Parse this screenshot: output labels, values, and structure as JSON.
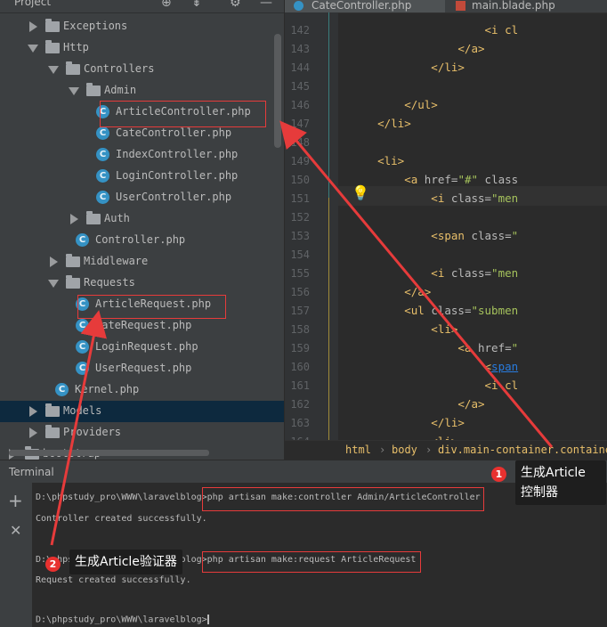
{
  "project": {
    "title": "Project",
    "tree": [
      {
        "label": "Exceptions",
        "type": "folder",
        "state": "closed"
      },
      {
        "label": "Http",
        "type": "folder",
        "state": "open"
      },
      {
        "label": "Controllers",
        "type": "folder",
        "state": "open"
      },
      {
        "label": "Admin",
        "type": "folder",
        "state": "open"
      },
      {
        "label": "ArticleController.php",
        "type": "class"
      },
      {
        "label": "CateController.php",
        "type": "class"
      },
      {
        "label": "IndexController.php",
        "type": "class"
      },
      {
        "label": "LoginController.php",
        "type": "class"
      },
      {
        "label": "UserController.php",
        "type": "class"
      },
      {
        "label": "Auth",
        "type": "folder",
        "state": "closed"
      },
      {
        "label": "Controller.php",
        "type": "class"
      },
      {
        "label": "Middleware",
        "type": "folder",
        "state": "closed"
      },
      {
        "label": "Requests",
        "type": "folder",
        "state": "open"
      },
      {
        "label": "ArticleRequest.php",
        "type": "class"
      },
      {
        "label": "CateRequest.php",
        "type": "class"
      },
      {
        "label": "LoginRequest.php",
        "type": "class"
      },
      {
        "label": "UserRequest.php",
        "type": "class"
      },
      {
        "label": "Kernel.php",
        "type": "class"
      },
      {
        "label": "Models",
        "type": "folder",
        "state": "closed"
      },
      {
        "label": "Providers",
        "type": "folder",
        "state": "closed"
      },
      {
        "label": "bootstrap",
        "type": "folder",
        "state": "closed"
      }
    ],
    "class_icon_letter": "C"
  },
  "editor": {
    "tabs": [
      {
        "label": "CateController.php"
      },
      {
        "label": "main.blade.php"
      }
    ],
    "lines": [
      {
        "n": "142",
        "segs": [
          {
            "c": "t",
            "v": "                    <i cl"
          }
        ]
      },
      {
        "n": "143",
        "segs": [
          {
            "c": "t",
            "v": "                </a>"
          }
        ]
      },
      {
        "n": "144",
        "segs": [
          {
            "c": "t",
            "v": "            </li>"
          }
        ]
      },
      {
        "n": "145",
        "segs": []
      },
      {
        "n": "146",
        "segs": [
          {
            "c": "t",
            "v": "        </ul>"
          }
        ]
      },
      {
        "n": "147",
        "segs": [
          {
            "c": "t",
            "v": "    </li>"
          }
        ]
      },
      {
        "n": "148",
        "segs": []
      },
      {
        "n": "149",
        "segs": [
          {
            "c": "t",
            "v": "    <li>"
          }
        ]
      },
      {
        "n": "150",
        "segs": [
          {
            "c": "t",
            "v": "        <a "
          },
          {
            "c": "a",
            "v": "href="
          },
          {
            "c": "s",
            "v": "\"#\""
          },
          {
            "c": "a",
            "v": " class"
          }
        ]
      },
      {
        "n": "151",
        "segs": [
          {
            "c": "t",
            "v": "            <i "
          },
          {
            "c": "a",
            "v": "class="
          },
          {
            "c": "s",
            "v": "\"men"
          }
        ]
      },
      {
        "n": "152",
        "segs": []
      },
      {
        "n": "153",
        "segs": [
          {
            "c": "t",
            "v": "            <span "
          },
          {
            "c": "a",
            "v": "class="
          },
          {
            "c": "s",
            "v": "\""
          }
        ]
      },
      {
        "n": "154",
        "segs": []
      },
      {
        "n": "155",
        "segs": [
          {
            "c": "t",
            "v": "            <i "
          },
          {
            "c": "a",
            "v": "class="
          },
          {
            "c": "s",
            "v": "\"men"
          }
        ]
      },
      {
        "n": "156",
        "segs": [
          {
            "c": "t",
            "v": "        </a>"
          }
        ]
      },
      {
        "n": "157",
        "segs": [
          {
            "c": "t",
            "v": "        <ul "
          },
          {
            "c": "a",
            "v": "class="
          },
          {
            "c": "s",
            "v": "\"submen"
          }
        ]
      },
      {
        "n": "158",
        "segs": [
          {
            "c": "t",
            "v": "            <li>"
          }
        ]
      },
      {
        "n": "159",
        "segs": [
          {
            "c": "t",
            "v": "                <a "
          },
          {
            "c": "a",
            "v": "href="
          },
          {
            "c": "s",
            "v": "\""
          }
        ]
      },
      {
        "n": "160",
        "segs": [
          {
            "c": "t",
            "v": "                    <"
          },
          {
            "c": "u",
            "v": "span"
          }
        ]
      },
      {
        "n": "161",
        "segs": [
          {
            "c": "t",
            "v": "                    <i cl"
          }
        ]
      },
      {
        "n": "162",
        "segs": [
          {
            "c": "t",
            "v": "                </a>"
          }
        ]
      },
      {
        "n": "163",
        "segs": [
          {
            "c": "t",
            "v": "            </li>"
          }
        ]
      },
      {
        "n": "164",
        "segs": [
          {
            "c": "t",
            "v": "            <li>"
          }
        ]
      }
    ],
    "breadcrumbs": [
      "html",
      "body",
      "div.main-container.containe"
    ]
  },
  "terminal": {
    "title": "Terminal",
    "lines": [
      {
        "prompt": "D:\\phpstudy_pro\\WWW\\laravelblog>",
        "cmd": "php artisan make:controller Admin/ArticleController"
      },
      {
        "out": "Controller created successfully."
      },
      {
        "prompt": "D:\\phpstudy_pro\\WWW\\laravelblog>",
        "cmd": "php artisan make:request ArticleRequest"
      },
      {
        "out": "Request created successfully."
      },
      {
        "prompt": "D:\\phpstudy_pro\\WWW\\laravelblog>",
        "cmd": ""
      }
    ],
    "add_label": "+",
    "close_label": "✕"
  },
  "annotations": [
    {
      "badge": "1",
      "text": "生成Article\n控制器"
    },
    {
      "badge": "2",
      "text": "生成Article验证器"
    }
  ],
  "colors": {
    "annotation_red": "#e63b3b",
    "selection": "#0d293e",
    "class_icon": "#3592c4"
  }
}
